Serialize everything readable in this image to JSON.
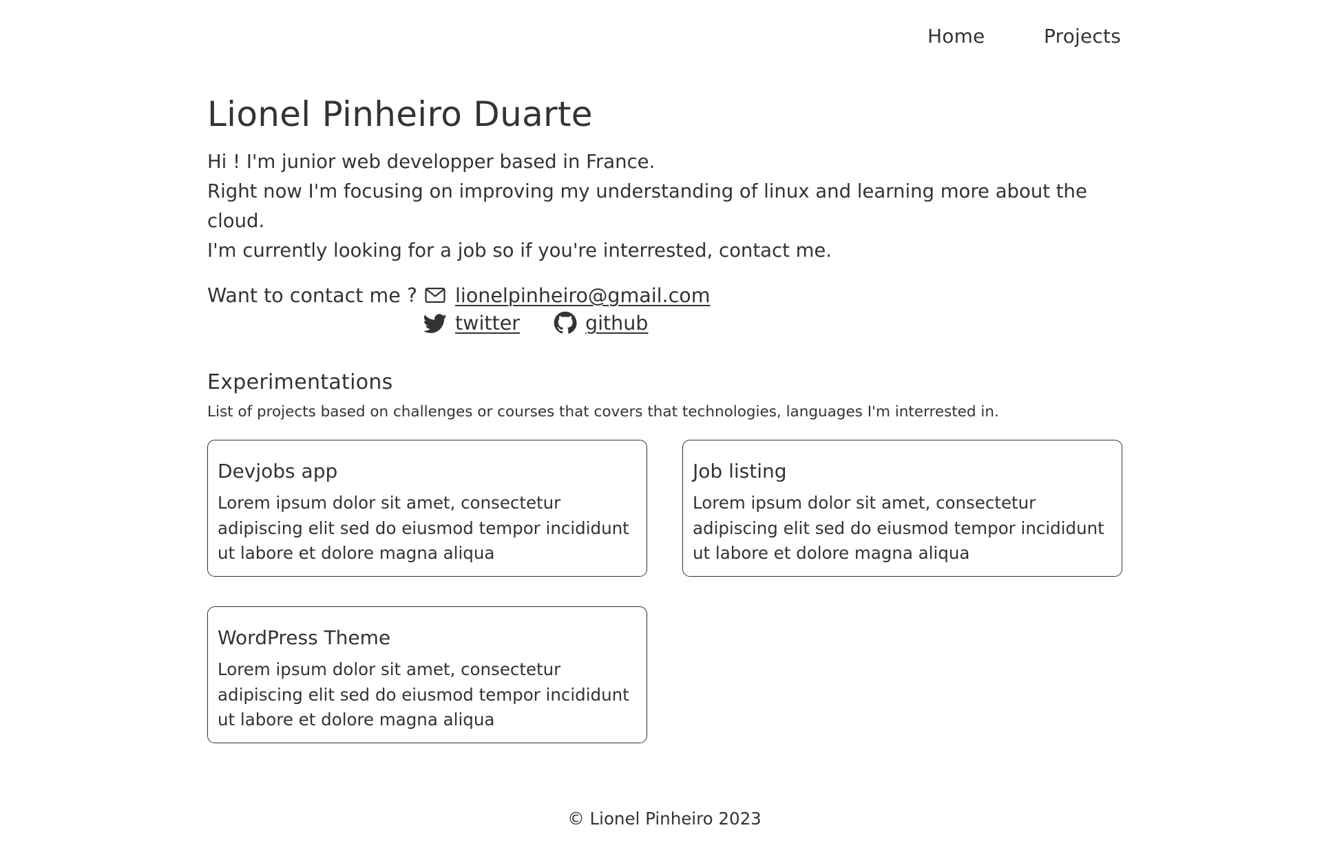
{
  "nav": {
    "home_label": "Home",
    "projects_label": "Projects"
  },
  "header": {
    "name": "Lionel Pinheiro Duarte"
  },
  "intro": {
    "lines": [
      "Hi ! I'm junior web developper based in France.",
      "Right now I'm focusing on improving my understanding of linux and learning more about the cloud.",
      "I'm currently looking for a job so if you're interrested, contact me."
    ]
  },
  "contact": {
    "label": "Want to contact me ?",
    "email": {
      "text": "lionelpinheiro@gmail.com",
      "icon": "envelope-icon"
    },
    "twitter": {
      "text": "twitter",
      "icon": "twitter-icon"
    },
    "github": {
      "text": "github",
      "icon": "github-icon"
    }
  },
  "experimentations": {
    "title": "Experimentations",
    "subtitle": "List of projects based on challenges or courses that covers that technologies, languages I'm interrested in.",
    "projects": [
      {
        "title": "Devjobs app",
        "description": "Lorem ipsum dolor sit amet, consectetur adipiscing elit sed do eiusmod tempor incididunt ut labore et dolore magna aliqua"
      },
      {
        "title": "Job listing",
        "description": "Lorem ipsum dolor sit amet, consectetur adipiscing elit sed do eiusmod tempor incididunt ut labore et dolore magna aliqua"
      },
      {
        "title": "WordPress Theme",
        "description": "Lorem ipsum dolor sit amet, consectetur adipiscing elit sed do eiusmod tempor incididunt ut labore et dolore magna aliqua"
      }
    ]
  },
  "footer": {
    "text": "© Lionel Pinheiro 2023"
  },
  "colors": {
    "text": "#333333",
    "background": "#ffffff",
    "border": "#333333"
  }
}
